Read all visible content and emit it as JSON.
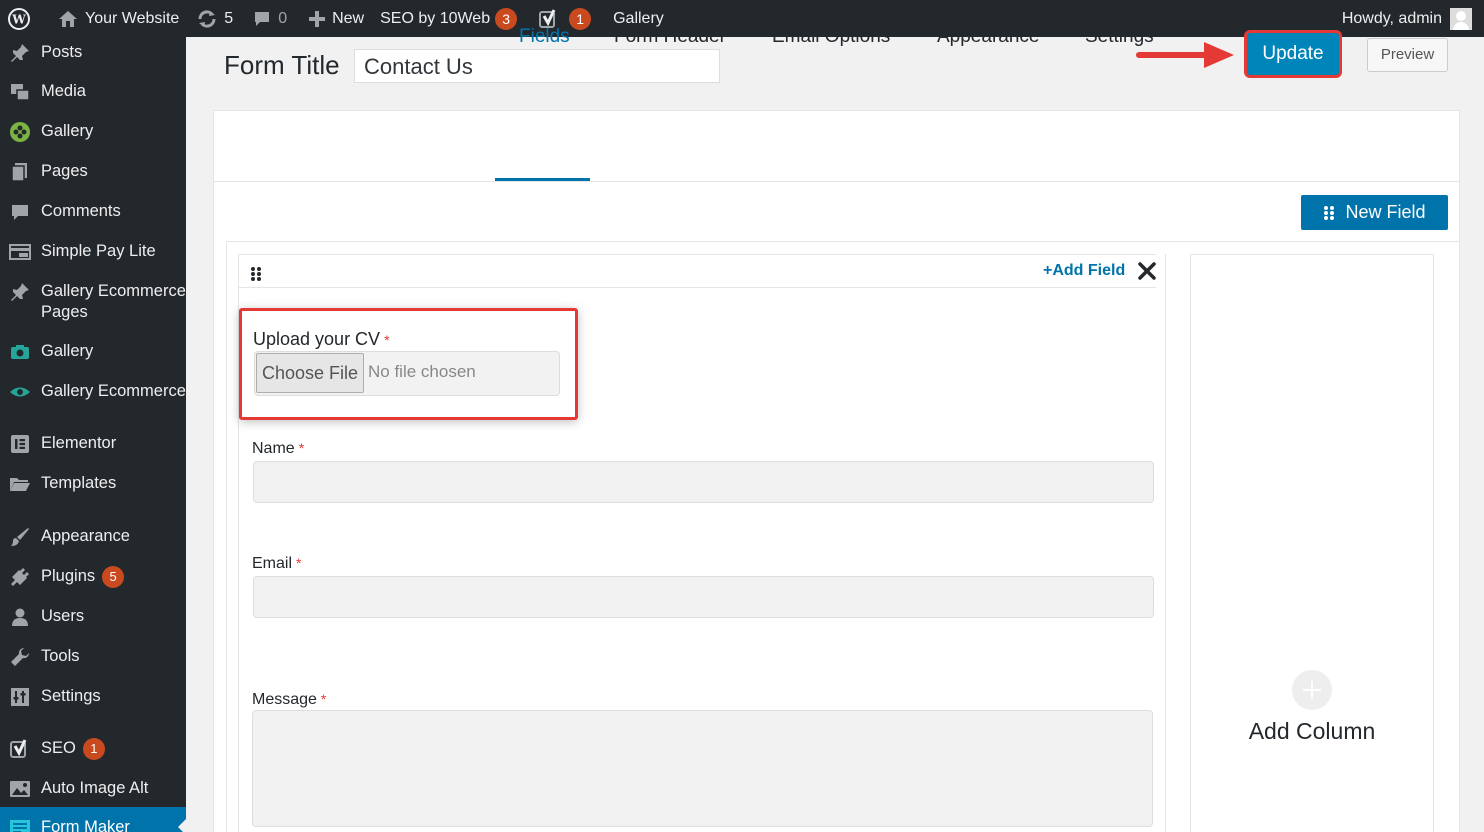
{
  "adminbar": {
    "site_name": "Your Website",
    "updates_count": "5",
    "comments_count": "0",
    "new_label": "New",
    "seo_label": "SEO by 10Web",
    "seo_count": "3",
    "yoast_count": "1",
    "gallery_label": "Gallery",
    "howdy": "Howdy, admin"
  },
  "sidebar": {
    "items": [
      {
        "label": "Posts",
        "icon": "pin-icon"
      },
      {
        "label": "Media",
        "icon": "media-icon"
      },
      {
        "label": "Gallery",
        "icon": "gallery-flower-icon"
      },
      {
        "label": "Pages",
        "icon": "pages-icon"
      },
      {
        "label": "Comments",
        "icon": "comment-icon"
      },
      {
        "label": "Simple Pay Lite",
        "icon": "payment-icon"
      },
      {
        "label": "Gallery Ecommerce Pages",
        "icon": "pin-icon"
      },
      {
        "label": "Gallery",
        "icon": "camera-icon"
      },
      {
        "label": "Gallery Ecommerce",
        "icon": "eye-icon"
      },
      {
        "label": "Elementor",
        "icon": "elementor-icon"
      },
      {
        "label": "Templates",
        "icon": "folder-icon"
      },
      {
        "label": "Appearance",
        "icon": "brush-icon"
      },
      {
        "label": "Plugins",
        "icon": "plug-icon",
        "badge": "5"
      },
      {
        "label": "Users",
        "icon": "user-icon"
      },
      {
        "label": "Tools",
        "icon": "wrench-icon"
      },
      {
        "label": "Settings",
        "icon": "settings-icon"
      },
      {
        "label": "SEO",
        "icon": "yoast-icon",
        "badge": "1"
      },
      {
        "label": "Auto Image Alt",
        "icon": "image-alt-icon"
      },
      {
        "label": "Form Maker",
        "icon": "form-icon",
        "active": true
      }
    ]
  },
  "header": {
    "form_title_label": "Form Title",
    "form_title_value": "Contact Us",
    "update_label": "Update",
    "preview_label": "Preview"
  },
  "tabs": [
    {
      "label": "Fields",
      "active": true
    },
    {
      "label": "Form Header"
    },
    {
      "label": "Email Options"
    },
    {
      "label": "Appearance"
    },
    {
      "label": "Settings"
    }
  ],
  "builder": {
    "new_field_label": "New Field",
    "add_field_label": "+Add Field",
    "add_column_label": "Add Column",
    "fields": {
      "upload": {
        "label": "Upload your CV",
        "required": "*",
        "button": "Choose File",
        "status": "No file chosen"
      },
      "name": {
        "label": "Name",
        "required": "*"
      },
      "email": {
        "label": "Email",
        "required": "*"
      },
      "message": {
        "label": "Message",
        "required": "*"
      }
    }
  },
  "colors": {
    "accent": "#0073aa",
    "update_button": "#0085ba",
    "highlight": "#e53935",
    "admin_dark": "#23282d",
    "badge": "#ca4a1f"
  }
}
